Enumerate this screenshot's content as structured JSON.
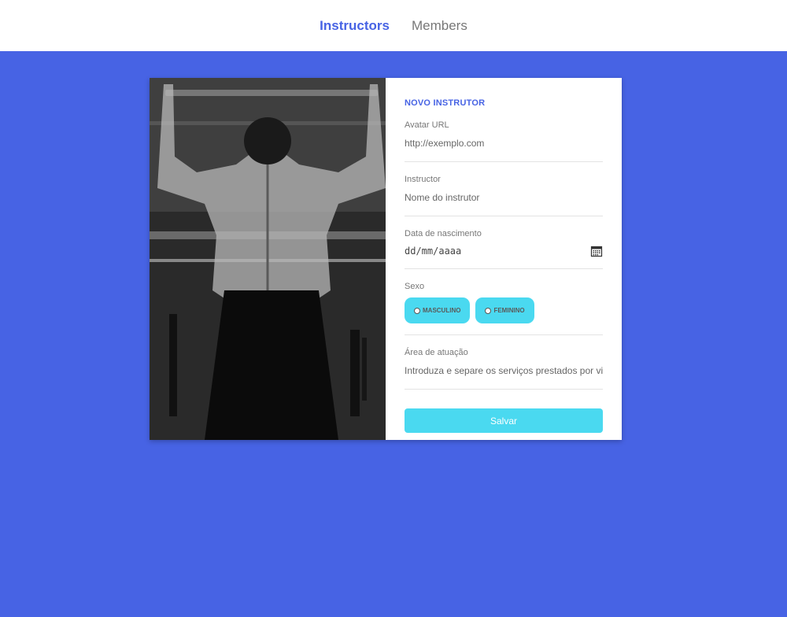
{
  "nav": {
    "items": [
      {
        "label": "Instructors",
        "active": true
      },
      {
        "label": "Members",
        "active": false
      }
    ]
  },
  "form": {
    "title": "Novo instrutor",
    "avatar": {
      "label": "Avatar URL",
      "placeholder": "http://exemplo.com"
    },
    "instructor": {
      "label": "Instructor",
      "placeholder": "Nome do instrutor"
    },
    "birth": {
      "label": "Data de nascimento",
      "placeholder": "dd/mm/aaaa"
    },
    "sex": {
      "label": "Sexo",
      "options": [
        "MASCULINO",
        "FEMININO"
      ]
    },
    "area": {
      "label": "Área de atuação",
      "placeholder": "Introduza e separe os serviços prestados por vi"
    },
    "submit_label": "Salvar"
  },
  "colors": {
    "primary": "#4763e4",
    "accent": "#4ad9f0",
    "background": "#4763e4"
  }
}
